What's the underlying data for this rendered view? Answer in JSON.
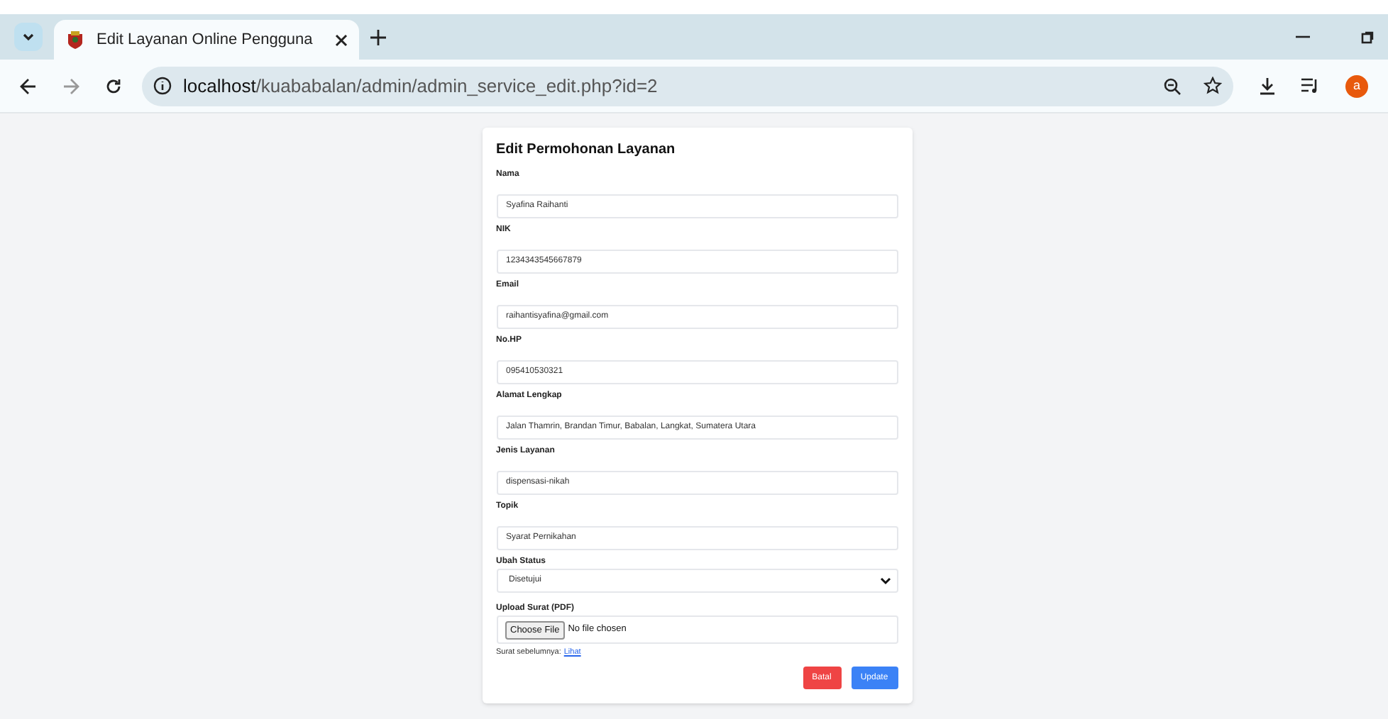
{
  "browser": {
    "tab_title": "Edit Layanan Online Pengguna",
    "url_host": "localhost",
    "url_path": "/kuababalan/admin/admin_service_edit.php?id=2",
    "profile_initial": "a"
  },
  "form": {
    "title": "Edit Permohonan Layanan",
    "fields": [
      {
        "kind": "text",
        "label": "Nama",
        "value": "Syafina Raihanti"
      },
      {
        "kind": "text",
        "label": "NIK",
        "value": "1234343545667879"
      },
      {
        "kind": "text",
        "label": "Email",
        "value": "raihantisyafina@gmail.com"
      },
      {
        "kind": "text",
        "label": "No.HP",
        "value": "095410530321"
      },
      {
        "kind": "text",
        "label": "Alamat Lengkap",
        "value": "Jalan Thamrin, Brandan Timur, Babalan, Langkat, Sumatera Utara"
      },
      {
        "kind": "text",
        "label": "Jenis Layanan",
        "value": "dispensasi-nikah"
      },
      {
        "kind": "text",
        "label": "Topik",
        "value": "Syarat Pernikahan"
      },
      {
        "kind": "select",
        "label": "Ubah Status",
        "value": "Disetujui"
      },
      {
        "kind": "file",
        "label": "Upload Surat (PDF)",
        "button": "Choose File",
        "value": "No file chosen"
      }
    ],
    "previous": {
      "text": "Surat sebelumnya:",
      "link": "Lihat"
    },
    "buttons": [
      {
        "kind": "cancel",
        "label": "Batal"
      },
      {
        "kind": "submit",
        "label": "Update"
      }
    ]
  }
}
